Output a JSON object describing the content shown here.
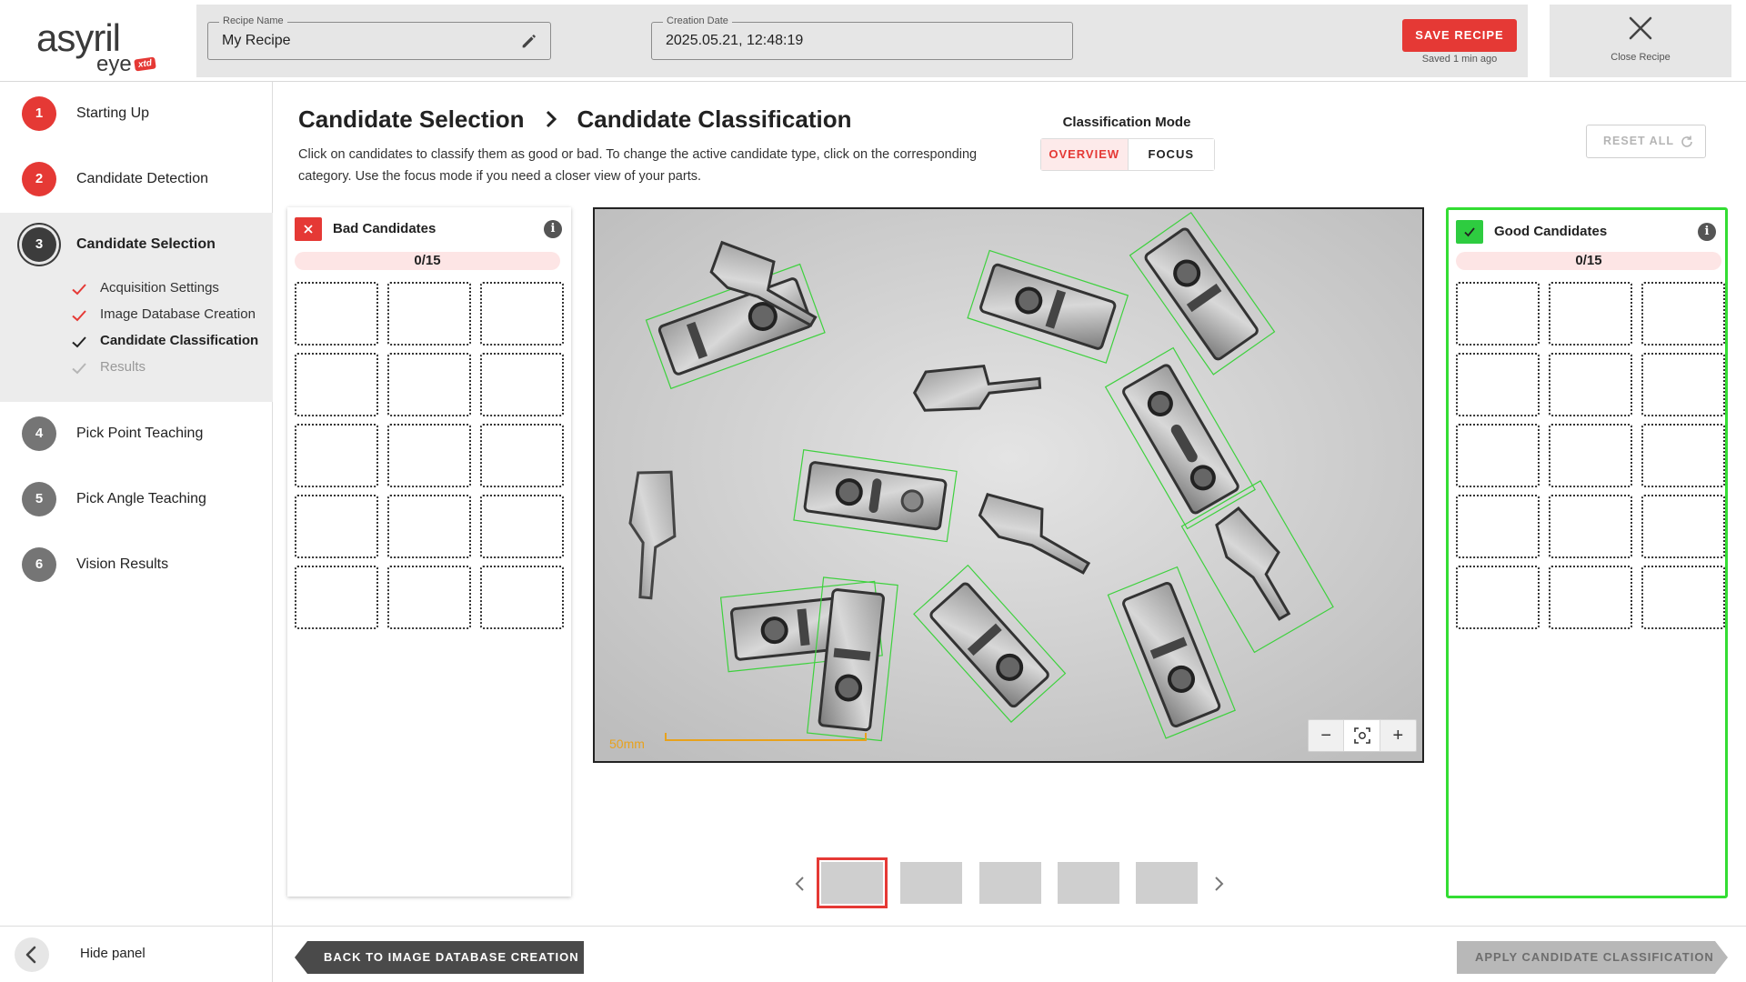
{
  "header": {
    "logo_main": "asyril",
    "logo_sub": "eye",
    "logo_badge": "xtd",
    "recipe_name_label": "Recipe Name",
    "recipe_name_value": "My Recipe",
    "creation_date_label": "Creation Date",
    "creation_date_value": "2025.05.21, 12:48:19",
    "save_label": "SAVE RECIPE",
    "saved_status": "Saved 1 min ago",
    "close_label": "Close Recipe"
  },
  "sidebar": {
    "steps": [
      {
        "number": "1",
        "label": "Starting Up",
        "state": "done"
      },
      {
        "number": "2",
        "label": "Candidate Detection",
        "state": "done"
      },
      {
        "number": "3",
        "label": "Candidate Selection",
        "state": "active"
      },
      {
        "number": "4",
        "label": "Pick Point Teaching",
        "state": "pending"
      },
      {
        "number": "5",
        "label": "Pick Angle Teaching",
        "state": "pending"
      },
      {
        "number": "6",
        "label": "Vision Results",
        "state": "pending"
      }
    ],
    "substeps": [
      {
        "label": "Acquisition Settings",
        "state": "done"
      },
      {
        "label": "Image Database Creation",
        "state": "done"
      },
      {
        "label": "Candidate Classification",
        "state": "current"
      },
      {
        "label": "Results",
        "state": "pending"
      }
    ],
    "hide_label": "Hide panel"
  },
  "main": {
    "breadcrumb_parent": "Candidate Selection",
    "breadcrumb_current": "Candidate Classification",
    "description": "Click on candidates to classify them as good or bad. To change the active candidate type, click on the corresponding category. Use the focus mode if you need a closer view of your parts.",
    "mode_title": "Classification Mode",
    "mode_overview": "OVERVIEW",
    "mode_focus": "FOCUS",
    "mode_selected": "OVERVIEW",
    "reset_label": "RESET ALL"
  },
  "bad_panel": {
    "title": "Bad Candidates",
    "count": "0/15",
    "slots": 15
  },
  "good_panel": {
    "title": "Good Candidates",
    "count": "0/15",
    "slots": 15
  },
  "viewer": {
    "scale_label": "50mm",
    "zoom_out": "−",
    "zoom_in": "+",
    "thumbnail_count": 5,
    "active_thumbnail": 1
  },
  "footer": {
    "back_label": "BACK TO IMAGE DATABASE CREATION",
    "apply_label": "APPLY CANDIDATE CLASSIFICATION"
  },
  "colors": {
    "accent_red": "#e53935",
    "good_green": "#33dd33",
    "detection_box": "#3ed13e",
    "scale_orange": "#e8a21c"
  }
}
